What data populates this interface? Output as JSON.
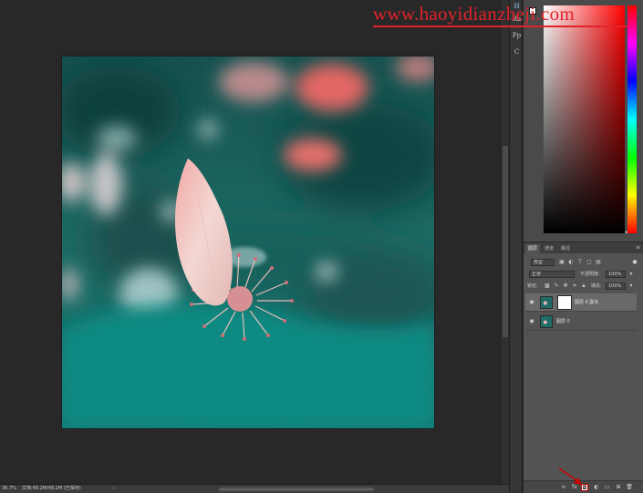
{
  "watermark": {
    "text": "www.haoyidianzheji.com"
  },
  "tool_dock": {
    "items": [
      {
        "label": "H"
      },
      {
        "label": "Ra"
      },
      {
        "label": "Pp"
      },
      {
        "label": "C"
      }
    ]
  },
  "status_bar": {
    "zoom": "36.7%",
    "doc_info": "文档:48.2M/48.2M (已保存)",
    "menu_arrow": "›"
  },
  "color_panel": {
    "hue_marker": "◂",
    "colors": {
      "base_hue": "#ff0000",
      "foreground": "#ffffff"
    }
  },
  "layers_panel": {
    "tabs": [
      {
        "label": "图层"
      },
      {
        "label": "通道"
      },
      {
        "label": "路径"
      }
    ],
    "menu_icon": "≡",
    "filter": {
      "value": "类型"
    },
    "blend_mode": {
      "value": "正常"
    },
    "opacity": {
      "label": "不透明度:",
      "value": "100%"
    },
    "lock": {
      "label": "锁定:"
    },
    "fill": {
      "label": "填充:",
      "value": "100%"
    },
    "layers": [
      {
        "name": "图层 0 副本",
        "selected": true,
        "has_mask": true
      },
      {
        "name": "图层 0",
        "selected": false,
        "has_mask": false
      }
    ],
    "eye_icon": "◉",
    "footer_icons": [
      "∞",
      "fx",
      "◘",
      "◐",
      "▭",
      "⊞",
      "🗑"
    ]
  },
  "accent_colors": {
    "watermark": "#e3222a",
    "arrow": "#cc0000",
    "photo_teal": "#1f6d66",
    "petal_pink": "#e7b9b4"
  }
}
